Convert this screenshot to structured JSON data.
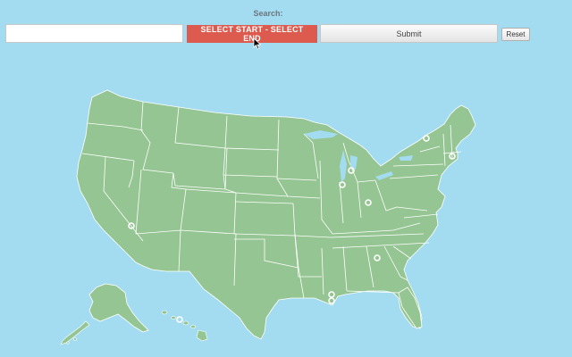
{
  "search": {
    "label": "Search:",
    "value": "",
    "placeholder": ""
  },
  "buttons": {
    "select_label": "SELECT START - SELECT END",
    "submit_label": "Submit",
    "reset_label": "Reset"
  },
  "colors": {
    "background": "#a3dcf0",
    "land": "#95c592",
    "border": "#ffffff",
    "select_button": "#dc5a4e"
  },
  "map": {
    "marker_count": 9
  }
}
